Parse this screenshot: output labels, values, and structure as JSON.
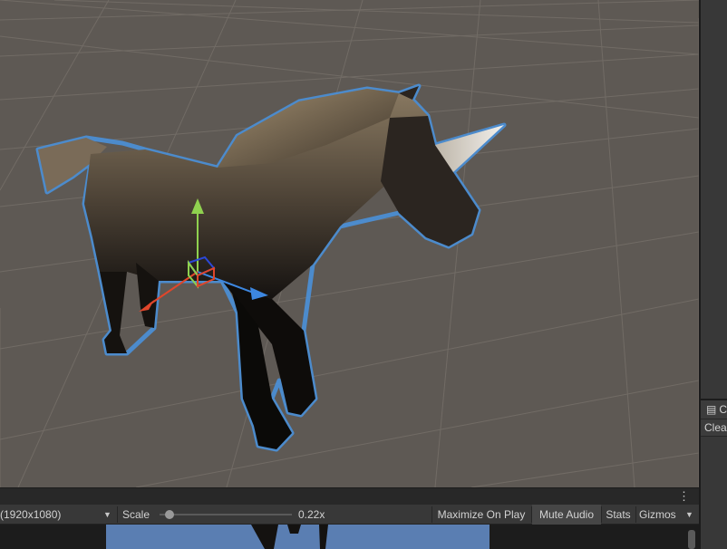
{
  "scene": {
    "object": "unicorn",
    "gizmo": "move-tool",
    "colors": {
      "ground": "#5e5954",
      "grid": "#78726b",
      "selection_outline": "#4a90d9"
    }
  },
  "console": {
    "tab_label": "C",
    "clear_label": "Clea"
  },
  "game_view": {
    "menu_glyph": "⋮",
    "resolution": "(1920x1080)",
    "scale_label": "Scale",
    "scale_value": "0.22x",
    "scale_fraction": 0.04,
    "maximize_on_play": "Maximize On Play",
    "mute_audio": "Mute Audio",
    "stats": "Stats",
    "gizmos": "Gizmos",
    "sky_color": "#5a7eb2"
  }
}
